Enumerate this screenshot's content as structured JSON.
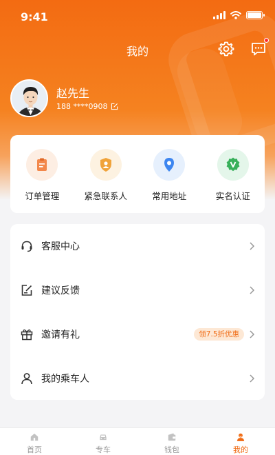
{
  "status_bar": {
    "time": "9:41"
  },
  "header": {
    "title": "我的"
  },
  "user": {
    "name": "赵先生",
    "phone": "188 ****0908"
  },
  "quick_actions": [
    {
      "label": "订单管理",
      "icon": "clipboard-icon",
      "color": "#f3884b",
      "bg": "#fdeee3"
    },
    {
      "label": "紧急联系人",
      "icon": "shield-person-icon",
      "color": "#f0a33a",
      "bg": "#fdf2e1"
    },
    {
      "label": "常用地址",
      "icon": "location-pin-icon",
      "color": "#3d86f0",
      "bg": "#e6f0fd"
    },
    {
      "label": "实名认证",
      "icon": "verified-shield-icon",
      "color": "#38b05a",
      "bg": "#e4f6ea"
    }
  ],
  "menu": [
    {
      "label": "客服中心",
      "icon": "headset-icon"
    },
    {
      "label": "建议反馈",
      "icon": "feedback-edit-icon"
    },
    {
      "label": "邀请有礼",
      "icon": "gift-icon",
      "badge": "领7.5折优惠"
    },
    {
      "label": "我的乘车人",
      "icon": "person-icon"
    }
  ],
  "tabbar": [
    {
      "label": "首页",
      "icon": "home-icon",
      "active": false
    },
    {
      "label": "专车",
      "icon": "car-icon",
      "active": false
    },
    {
      "label": "钱包",
      "icon": "wallet-icon",
      "active": false
    },
    {
      "label": "我的",
      "icon": "profile-icon",
      "active": true
    }
  ],
  "colors": {
    "brand": "#f58220",
    "accent": "#f06a12",
    "background": "#f4f4f6"
  }
}
